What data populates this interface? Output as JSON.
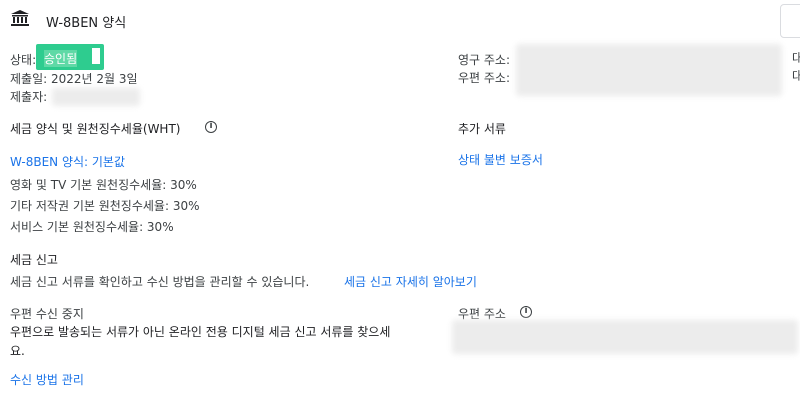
{
  "header": {
    "title": "W-8BEN 양식"
  },
  "status": {
    "label": "상태:",
    "value": "승인됨",
    "submitted_date": "제출일: 2022년 2월 3일",
    "submitter_label": "제출자:"
  },
  "address": {
    "permanent_label": "영구 주소:",
    "mailing_label": "우편 주소:",
    "right_edge_chars": [
      "대",
      "대"
    ]
  },
  "tax": {
    "heading": "세금 양식 및 원천징수세율(WHT)",
    "form_link": "W-8BEN 양식: 기본값",
    "rates": [
      "영화 및 TV 기본 원천징수세율: 30%",
      "기타 저작권 기본 원천징수세율: 30%",
      "서비스 기본 원천징수세율: 30%"
    ]
  },
  "additional": {
    "heading": "추가 서류",
    "link": "상태 불변 보증서"
  },
  "reporting": {
    "heading": "세금 신고",
    "description": "세금 신고 서류를 확인하고 수신 방법을 관리할 수 있습니다.",
    "learn_more": "세금 신고 자세히 알아보기"
  },
  "paperless": {
    "heading": "우편 수신 중지",
    "description_line1": "우편으로 발송되는 서류가 아닌 온라인 전용 디지털 세금 신고 서류를 찾으세",
    "description_line2": "요.",
    "manage_link": "수신 방법 관리"
  },
  "mail_address": {
    "label": "우편 주소"
  },
  "colors": {
    "link": "#1a73e8",
    "approved_highlight": "#2ecc8f"
  },
  "icons": {
    "header": "bank-icon",
    "info": "info-icon"
  }
}
